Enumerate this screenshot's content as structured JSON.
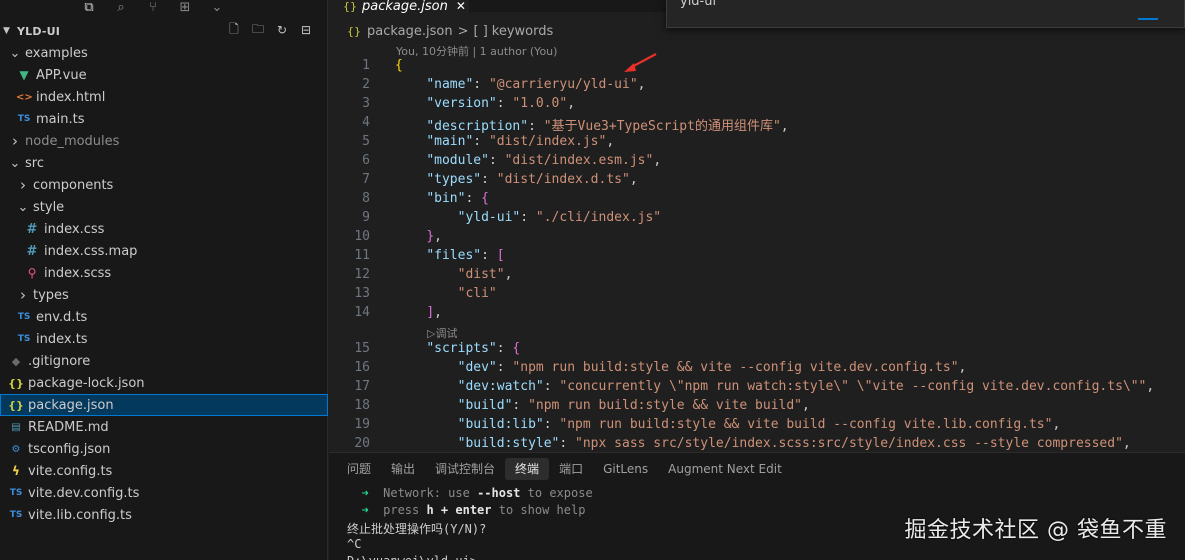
{
  "activity": {
    "icons": [
      "files-icon",
      "search-icon",
      "source-control-icon",
      "extensions-icon",
      "chevron-down-icon"
    ]
  },
  "explorer": {
    "root": "YLD-UI",
    "items": [
      {
        "label": "examples",
        "depth": 0,
        "kind": "folder-open"
      },
      {
        "label": "APP.vue",
        "depth": 1,
        "kind": "vue"
      },
      {
        "label": "index.html",
        "depth": 1,
        "kind": "html"
      },
      {
        "label": "main.ts",
        "depth": 1,
        "kind": "ts"
      },
      {
        "label": "node_modules",
        "depth": 0,
        "kind": "folder-closed",
        "dim": true
      },
      {
        "label": "src",
        "depth": 0,
        "kind": "folder-open"
      },
      {
        "label": "components",
        "depth": 1,
        "kind": "folder-closed"
      },
      {
        "label": "style",
        "depth": 1,
        "kind": "folder-open"
      },
      {
        "label": "index.css",
        "depth": 2,
        "kind": "css"
      },
      {
        "label": "index.css.map",
        "depth": 2,
        "kind": "css"
      },
      {
        "label": "index.scss",
        "depth": 2,
        "kind": "scss"
      },
      {
        "label": "types",
        "depth": 1,
        "kind": "folder-closed"
      },
      {
        "label": "env.d.ts",
        "depth": 1,
        "kind": "ts"
      },
      {
        "label": "index.ts",
        "depth": 1,
        "kind": "ts"
      },
      {
        "label": ".gitignore",
        "depth": 0,
        "kind": "git"
      },
      {
        "label": "package-lock.json",
        "depth": 0,
        "kind": "json"
      },
      {
        "label": "package.json",
        "depth": 0,
        "kind": "json",
        "selected": true
      },
      {
        "label": "README.md",
        "depth": 0,
        "kind": "md"
      },
      {
        "label": "tsconfig.json",
        "depth": 0,
        "kind": "tsconfig"
      },
      {
        "label": "vite.config.ts",
        "depth": 0,
        "kind": "vite"
      },
      {
        "label": "vite.dev.config.ts",
        "depth": 0,
        "kind": "ts"
      },
      {
        "label": "vite.lib.config.ts",
        "depth": 0,
        "kind": "ts"
      }
    ]
  },
  "editor": {
    "tab": {
      "icon": "{}",
      "label": "package.json",
      "close": "✕"
    },
    "command_input": "yld-ui",
    "breadcrumb": {
      "file": "package.json",
      "sep": ">",
      "symbol_icon": "[ ]",
      "symbol": "keywords"
    },
    "codelens": "You, 10分钟前 | 1 author (You)",
    "lines": [
      {
        "n": "1",
        "tokens": [
          [
            "b1",
            "{"
          ]
        ]
      },
      {
        "n": "2",
        "tokens": [
          [
            "p",
            "    "
          ],
          [
            "k",
            "\"name\""
          ],
          [
            "p",
            ": "
          ],
          [
            "s",
            "\"@carrieryu/yld-ui\""
          ],
          [
            "p",
            ","
          ]
        ]
      },
      {
        "n": "3",
        "tokens": [
          [
            "p",
            "    "
          ],
          [
            "k",
            "\"version\""
          ],
          [
            "p",
            ": "
          ],
          [
            "s",
            "\"1.0.0\""
          ],
          [
            "p",
            ","
          ]
        ]
      },
      {
        "n": "4",
        "tokens": [
          [
            "p",
            "    "
          ],
          [
            "k",
            "\"description\""
          ],
          [
            "p",
            ": "
          ],
          [
            "s",
            "\"基于Vue3+TypeScript的通用组件库\""
          ],
          [
            "p",
            ","
          ]
        ]
      },
      {
        "n": "5",
        "tokens": [
          [
            "p",
            "    "
          ],
          [
            "k",
            "\"main\""
          ],
          [
            "p",
            ": "
          ],
          [
            "s",
            "\"dist/index.js\""
          ],
          [
            "p",
            ","
          ]
        ]
      },
      {
        "n": "6",
        "tokens": [
          [
            "p",
            "    "
          ],
          [
            "k",
            "\"module\""
          ],
          [
            "p",
            ": "
          ],
          [
            "s",
            "\"dist/index.esm.js\""
          ],
          [
            "p",
            ","
          ]
        ]
      },
      {
        "n": "7",
        "tokens": [
          [
            "p",
            "    "
          ],
          [
            "k",
            "\"types\""
          ],
          [
            "p",
            ": "
          ],
          [
            "s",
            "\"dist/index.d.ts\""
          ],
          [
            "p",
            ","
          ]
        ]
      },
      {
        "n": "8",
        "tokens": [
          [
            "p",
            "    "
          ],
          [
            "k",
            "\"bin\""
          ],
          [
            "p",
            ": "
          ],
          [
            "b2",
            "{"
          ]
        ]
      },
      {
        "n": "9",
        "tokens": [
          [
            "p",
            "        "
          ],
          [
            "k",
            "\"yld-ui\""
          ],
          [
            "p",
            ": "
          ],
          [
            "s",
            "\"./cli/index.js\""
          ]
        ]
      },
      {
        "n": "10",
        "tokens": [
          [
            "p",
            "    "
          ],
          [
            "b2",
            "}"
          ],
          [
            "p",
            ","
          ]
        ]
      },
      {
        "n": "11",
        "tokens": [
          [
            "p",
            "    "
          ],
          [
            "k",
            "\"files\""
          ],
          [
            "p",
            ": "
          ],
          [
            "b2",
            "["
          ]
        ]
      },
      {
        "n": "12",
        "tokens": [
          [
            "p",
            "        "
          ],
          [
            "s",
            "\"dist\""
          ],
          [
            "p",
            ","
          ]
        ]
      },
      {
        "n": "13",
        "tokens": [
          [
            "p",
            "        "
          ],
          [
            "s",
            "\"cli\""
          ]
        ]
      },
      {
        "n": "14",
        "tokens": [
          [
            "p",
            "    "
          ],
          [
            "b2",
            "]"
          ],
          [
            "p",
            ","
          ]
        ]
      },
      {
        "n": "",
        "lens": "▷调试"
      },
      {
        "n": "15",
        "tokens": [
          [
            "p",
            "    "
          ],
          [
            "k",
            "\"scripts\""
          ],
          [
            "p",
            ": "
          ],
          [
            "b2",
            "{"
          ]
        ]
      },
      {
        "n": "16",
        "tokens": [
          [
            "p",
            "        "
          ],
          [
            "k",
            "\"dev\""
          ],
          [
            "p",
            ": "
          ],
          [
            "s",
            "\"npm run build:style && vite --config vite.dev.config.ts\""
          ],
          [
            "p",
            ","
          ]
        ]
      },
      {
        "n": "17",
        "tokens": [
          [
            "p",
            "        "
          ],
          [
            "k",
            "\"dev:watch\""
          ],
          [
            "p",
            ": "
          ],
          [
            "s",
            "\"concurrently \\\"npm run watch:style\\\" \\\"vite --config vite.dev.config.ts\\\"\""
          ],
          [
            "p",
            ","
          ]
        ]
      },
      {
        "n": "18",
        "tokens": [
          [
            "p",
            "        "
          ],
          [
            "k",
            "\"build\""
          ],
          [
            "p",
            ": "
          ],
          [
            "s",
            "\"npm run build:style && vite build\""
          ],
          [
            "p",
            ","
          ]
        ]
      },
      {
        "n": "19",
        "tokens": [
          [
            "p",
            "        "
          ],
          [
            "k",
            "\"build:lib\""
          ],
          [
            "p",
            ": "
          ],
          [
            "s",
            "\"npm run build:style && vite build --config vite.lib.config.ts\""
          ],
          [
            "p",
            ","
          ]
        ]
      },
      {
        "n": "20",
        "tokens": [
          [
            "p",
            "        "
          ],
          [
            "k",
            "\"build:style\""
          ],
          [
            "p",
            ": "
          ],
          [
            "s",
            "\"npx sass src/style/index.scss:src/style/index.css --style compressed\""
          ],
          [
            "p",
            ","
          ]
        ]
      }
    ]
  },
  "panel": {
    "tabs": [
      "问题",
      "输出",
      "调试控制台",
      "终端",
      "端口",
      "GitLens",
      "Augment Next Edit"
    ],
    "active_tab": "终端",
    "terminal": [
      [
        [
          "g",
          "  ➜  "
        ],
        [
          "dm",
          "Network"
        ],
        [
          "dm",
          ": use "
        ],
        [
          "bw",
          "--host"
        ],
        [
          "dm",
          " to expose"
        ]
      ],
      [
        [
          "g",
          "  ➜  "
        ],
        [
          "dm",
          "press "
        ],
        [
          "bw",
          "h + enter"
        ],
        [
          "dm",
          " to show help"
        ]
      ],
      [
        [
          "p",
          "终止批处理操作吗(Y/N)?"
        ]
      ],
      [
        [
          "p",
          "^C"
        ]
      ],
      [
        [
          "p",
          "D:\\yuanwei\\yld-ui>"
        ]
      ]
    ]
  },
  "watermark": "掘金技术社区 @ 袋鱼不重",
  "colors": {
    "accent": "#0078d4",
    "selection": "#04395e",
    "key": "#9cdcfe",
    "string": "#ce9178"
  }
}
